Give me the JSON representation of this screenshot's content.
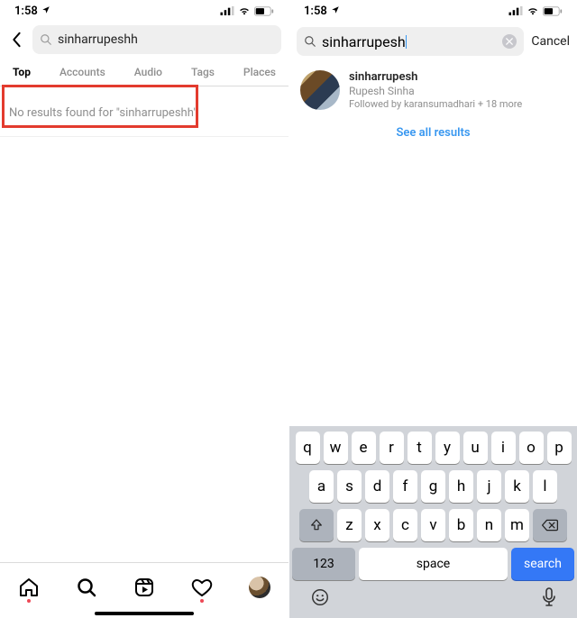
{
  "status": {
    "time": "1:58",
    "location_arrow": "➤"
  },
  "left": {
    "search_query": "sinharrupeshh",
    "tabs": {
      "top": "Top",
      "accounts": "Accounts",
      "audio": "Audio",
      "tags": "Tags",
      "places": "Places"
    },
    "no_results": "No results found for \"sinharrupeshh\""
  },
  "right": {
    "search_query": "sinharrupesh",
    "cancel": "Cancel",
    "result": {
      "username": "sinharrupesh",
      "display_name": "Rupesh Sinha",
      "followed_by": "Followed by karansumadhari + 18 more"
    },
    "see_all": "See all results"
  },
  "keyboard": {
    "row1": [
      "q",
      "w",
      "e",
      "r",
      "t",
      "y",
      "u",
      "i",
      "o",
      "p"
    ],
    "row2": [
      "a",
      "s",
      "d",
      "f",
      "g",
      "h",
      "j",
      "k",
      "l"
    ],
    "row3": [
      "z",
      "x",
      "c",
      "v",
      "b",
      "n",
      "m"
    ],
    "numbers": "123",
    "space": "space",
    "search": "search"
  }
}
